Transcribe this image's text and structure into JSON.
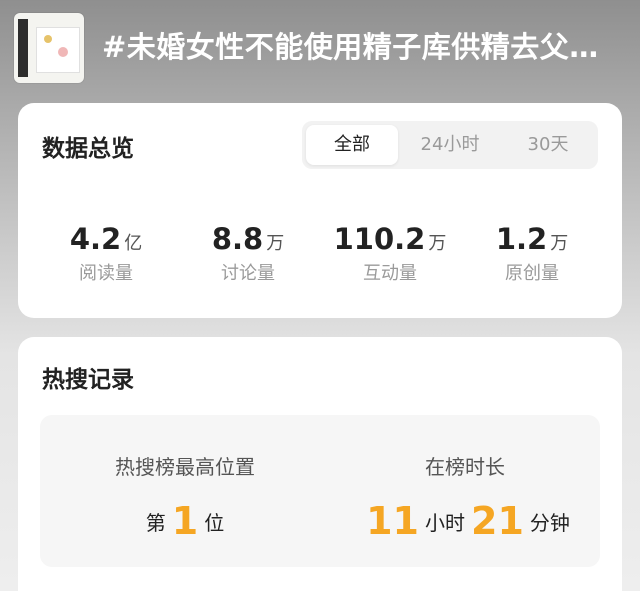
{
  "header": {
    "title": "#未婚女性不能使用精子库供精去父…",
    "thumbnail_icon": "topic-thumbnail"
  },
  "overview": {
    "title": "数据总览",
    "tabs": [
      {
        "label": "全部",
        "active": true
      },
      {
        "label": "24小时",
        "active": false
      },
      {
        "label": "30天",
        "active": false
      }
    ],
    "stats": [
      {
        "value": "4.2",
        "unit": "亿",
        "label": "阅读量"
      },
      {
        "value": "8.8",
        "unit": "万",
        "label": "讨论量"
      },
      {
        "value": "110.2",
        "unit": "万",
        "label": "互动量"
      },
      {
        "value": "1.2",
        "unit": "万",
        "label": "原创量"
      }
    ]
  },
  "hot_search": {
    "title": "热搜记录",
    "highest_position": {
      "label": "热搜榜最高位置",
      "prefix": "第",
      "value": "1",
      "suffix": "位"
    },
    "duration": {
      "label": "在榜时长",
      "hours": "11",
      "hours_unit": "小时",
      "minutes": "21",
      "minutes_unit": "分钟"
    }
  },
  "colors": {
    "accent": "#f5a623",
    "text_primary": "#222222",
    "text_secondary": "#9a9a9a"
  }
}
